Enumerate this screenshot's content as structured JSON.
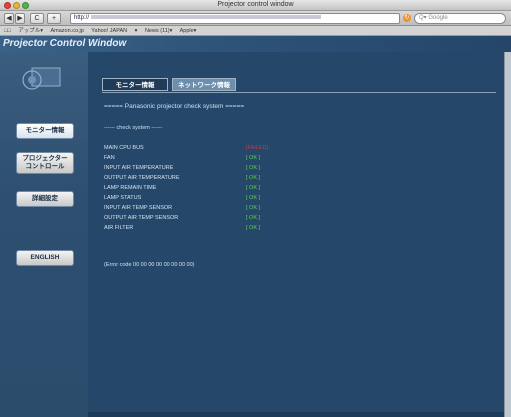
{
  "window": {
    "title": "Projector control window"
  },
  "toolbar": {
    "back": "◀",
    "forward": "▶",
    "stop": "C",
    "add": "+",
    "url_prefix": "http://",
    "reload": "↻",
    "search_placeholder": "Q▾ Google"
  },
  "bookmarks": [
    "□□",
    "アップル▾",
    "Amazon.co.jp",
    "Yahoo! JAPAN",
    "▾",
    "News (11)▾",
    "Apple▾"
  ],
  "app": {
    "title": "Projector Control Window"
  },
  "sidebar": {
    "items": [
      {
        "label_line1": "モニター情報",
        "label_line2": ""
      },
      {
        "label_line1": "プロジェクター",
        "label_line2": "コントロール"
      },
      {
        "label_line1": "詳細設定",
        "label_line2": ""
      },
      {
        "label_line1": "ENGLISH",
        "label_line2": ""
      }
    ]
  },
  "tabs": [
    {
      "label": "モニター情報"
    },
    {
      "label": "ネットワーク情報"
    }
  ],
  "main": {
    "system_title": "===== Panasonic projector check system =====",
    "subhead": "------ check system ------",
    "rows": [
      {
        "label": "MAIN CPU BUS",
        "value": "[FAILED]"
      },
      {
        "label": "FAN",
        "value": "[ OK ]"
      },
      {
        "label": "INPUT AIR TEMPERATURE",
        "value": "[ OK ]"
      },
      {
        "label": "OUTPUT AIR TEMPERATURE",
        "value": "[ OK ]"
      },
      {
        "label": "LAMP REMAIN TIME",
        "value": "[ OK ]"
      },
      {
        "label": "LAMP STATUS",
        "value": "[ OK ]"
      },
      {
        "label": "INPUT AIR TEMP SENSOR",
        "value": "[ OK ]"
      },
      {
        "label": "OUTPUT AIR TEMP SENSOR",
        "value": "[ OK ]"
      },
      {
        "label": "AIR FILTER",
        "value": "[ OK ]"
      }
    ],
    "error_code": "(Error code 00 00 00 00 00 00 00 00)"
  },
  "colors": {
    "ok": "#5fd24a",
    "failed": "#e0303a"
  }
}
